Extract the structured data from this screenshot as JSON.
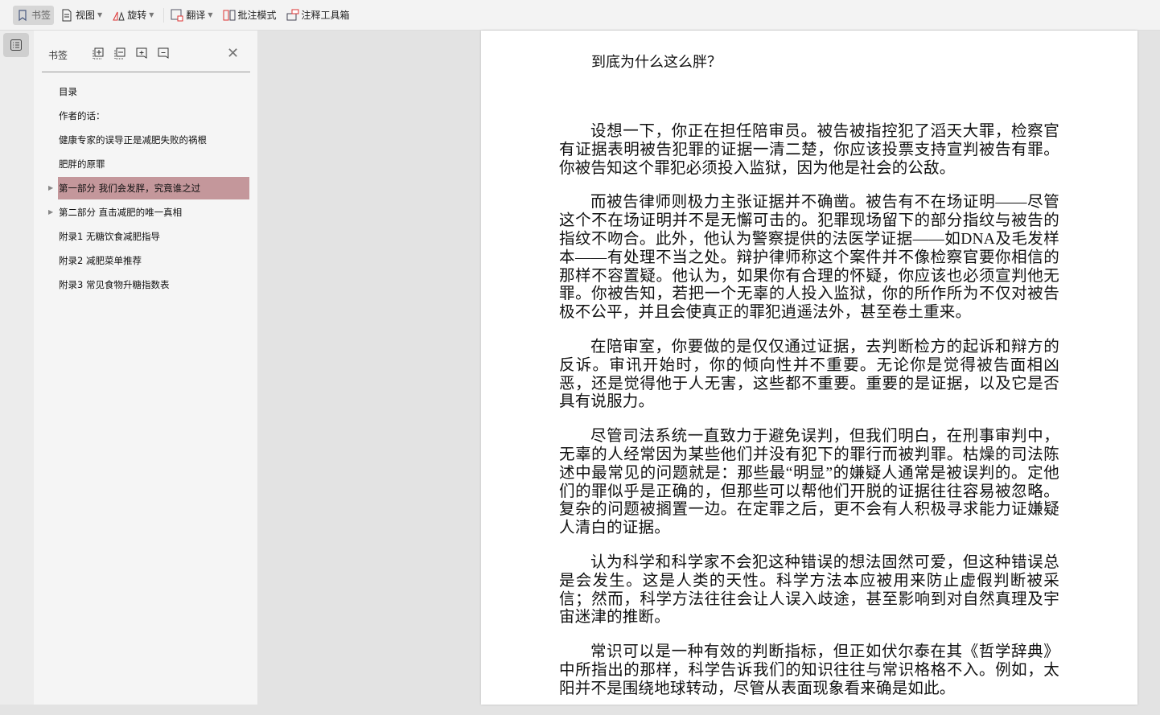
{
  "toolbar": {
    "bookmark": "书签",
    "view": "视图",
    "rotate": "旋转",
    "translate": "翻译",
    "annotate_mode": "批注模式",
    "annotation_tools": "注释工具箱"
  },
  "panel": {
    "title": "书签",
    "items": [
      {
        "label": "目录",
        "expandable": false,
        "selected": false
      },
      {
        "label": "作者的话：",
        "expandable": false,
        "selected": false
      },
      {
        "label": "健康专家的误导正是减肥失败的祸根",
        "expandable": false,
        "selected": false
      },
      {
        "label": "肥胖的原罪",
        "expandable": false,
        "selected": false
      },
      {
        "label": "第一部分 我们会发胖，究竟谁之过",
        "expandable": true,
        "selected": true
      },
      {
        "label": "第二部分 直击减肥的唯一真相",
        "expandable": true,
        "selected": false
      },
      {
        "label": "附录1 无糖饮食减肥指导",
        "expandable": false,
        "selected": false
      },
      {
        "label": "附录2 减肥菜单推荐",
        "expandable": false,
        "selected": false
      },
      {
        "label": "附录3 常见食物升糖指数表",
        "expandable": false,
        "selected": false
      }
    ]
  },
  "document": {
    "title": "到底为什么这么胖？",
    "paragraphs": [
      "设想一下，你正在担任陪审员。被告被指控犯了滔天大罪，检察官有证据表明被告犯罪的证据一清二楚，你应该投票支持宣判被告有罪。你被告知这个罪犯必须投入监狱，因为他是社会的公敌。",
      "而被告律师则极力主张证据并不确凿。被告有不在场证明——尽管这个不在场证明并不是无懈可击的。犯罪现场留下的部分指纹与被告的指纹不吻合。此外，他认为警察提供的法医学证据——如DNA及毛发样本——有处理不当之处。辩护律师称这个案件并不像检察官要你相信的那样不容置疑。他认为，如果你有合理的怀疑，你应该也必须宣判他无罪。你被告知，若把一个无辜的人投入监狱，你的所作所为不仅对被告极不公平，并且会使真正的罪犯逍遥法外，甚至卷土重来。",
      "在陪审室，你要做的是仅仅通过证据，去判断检方的起诉和辩方的反诉。审讯开始时，你的倾向性并不重要。无论你是觉得被告面相凶恶，还是觉得他于人无害，这些都不重要。重要的是证据，以及它是否具有说服力。",
      "尽管司法系统一直致力于避免误判，但我们明白，在刑事审判中，无辜的人经常因为某些他们并没有犯下的罪行而被判罪。枯燥的司法陈述中最常见的问题就是：那些最“明显”的嫌疑人通常是被误判的。定他们的罪似乎是正确的，但那些可以帮他们开脱的证据往往容易被忽略。复杂的问题被搁置一边。在定罪之后，更不会有人积极寻求能力证嫌疑人清白的证据。",
      "认为科学和科学家不会犯这种错误的想法固然可爱，但这种错误总是会发生。这是人类的天性。科学方法本应被用来防止虚假判断被采信；然而，科学方法往往会让人误入歧途，甚至影响到对自然真理及宇宙迷津的推断。",
      "常识可以是一种有效的判断指标，但正如伏尔泰在其《哲学辞典》中所指出的那样，科学告诉我们的知识往往与常识格格不入。例如，太阳并不是围绕地球转动，尽管从表面现象看来确是如此。"
    ]
  }
}
